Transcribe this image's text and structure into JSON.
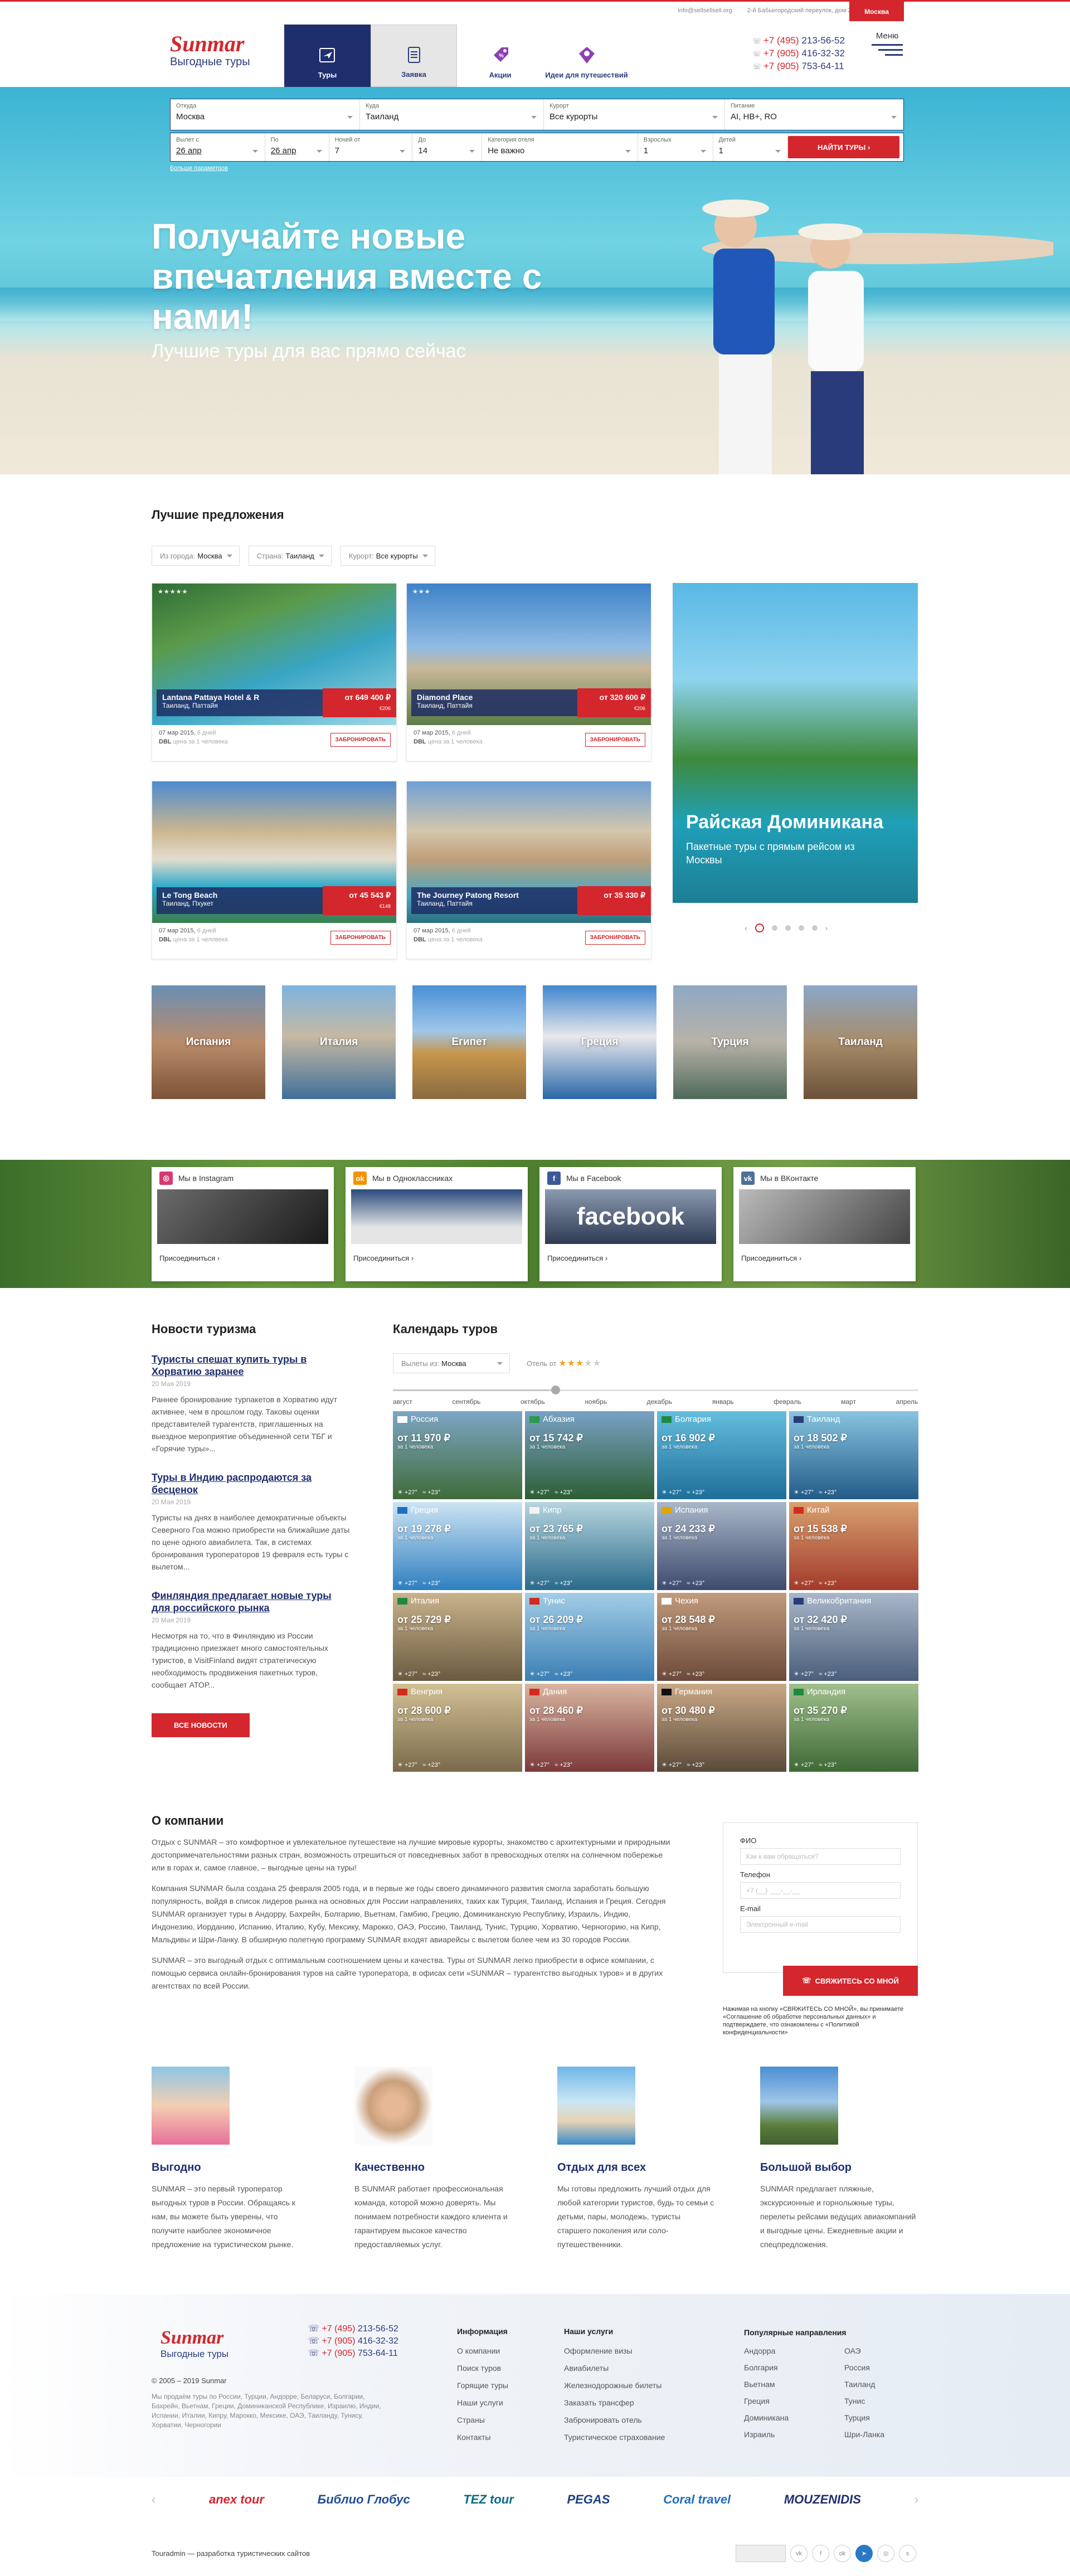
{
  "topbar": {
    "email": "info@sellsellsell.org",
    "address": "2-й Бабьегородский переулок, дом 2, офис 211, 4 этаж",
    "city": "Москва"
  },
  "header": {
    "logo_text": "Sunmar",
    "logo_sub": "Выгодные туры",
    "nav": [
      {
        "label": "Туры"
      },
      {
        "label": "Заявка"
      },
      {
        "label": "Акции"
      },
      {
        "label": "Идеи для путешествий"
      }
    ],
    "phones": [
      {
        "code": "+7 (495)",
        "num": "213-56-52"
      },
      {
        "code": "+7 (905)",
        "num": "416-32-32"
      },
      {
        "code": "+7 (905)",
        "num": "753-64-11"
      }
    ],
    "menu_label": "Меню"
  },
  "search": {
    "from_label": "Откуда",
    "from": "Москва",
    "to_label": "Куда",
    "to": "Таиланд",
    "resort_label": "Курорт",
    "resort": "Все курорты",
    "meal_label": "Питание",
    "meal": "AI, HB+, RO",
    "date1_label": "Вылет с",
    "date1": "26 апр",
    "date2_label": "По",
    "date2": "26 апр",
    "nights1_label": "Ночей от",
    "nights1": "7",
    "nights2_label": "До",
    "nights2": "14",
    "category_label": "Категория отеля",
    "category": "Не важно",
    "adults_label": "Взрослых",
    "adults": "1",
    "children_label": "Детей",
    "children": "1",
    "find": "НАЙТИ ТУРЫ",
    "more": "Больше параметров"
  },
  "hero": {
    "title": "Получайте новые впечатления вместе с нами!",
    "subtitle": "Лучшие туры для вас прямо сейчас"
  },
  "offers": {
    "title": "Лучшие предложения",
    "filters": [
      {
        "label": "Из города:",
        "value": "Москва"
      },
      {
        "label": "Страна:",
        "value": "Таиланд"
      },
      {
        "label": "Курорт:",
        "value": "Все курорты"
      }
    ],
    "cards": [
      {
        "stars": "★★★★★",
        "name": "Lantana Pattaya Hotel & R",
        "place": "Таиланд, Паттайя",
        "price": "от 649 400 ₽",
        "meal": "€206",
        "date": "07 мар 2015",
        "nights": "6 дней",
        "pax": "DBL",
        "people": "цена за 1 человека",
        "book": "ЗАБРОНИРОВАТЬ"
      },
      {
        "stars": "★★★",
        "name": "Diamond Place",
        "place": "Таиланд, Паттайя",
        "price": "от 320 600 ₽",
        "meal": "€206",
        "date": "07 мар 2015",
        "nights": "6 дней",
        "pax": "DBL",
        "people": "цена за 1 человека",
        "book": "ЗАБРОНИРОВАТЬ"
      },
      {
        "stars": "",
        "name": "Le Tong Beach",
        "place": "Таиланд, Пхукет",
        "price": "от 45 543 ₽",
        "meal": "€148",
        "date": "07 мар 2015",
        "nights": "6 дней",
        "pax": "DBL",
        "people": "цена за 1 человека",
        "book": "ЗАБРОНИРОВАТЬ"
      },
      {
        "stars": "",
        "name": "The Journey Patong Resort",
        "place": "Таиланд, Паттайя",
        "price": "от 35 330 ₽",
        "meal": "",
        "date": "07 мар 2015",
        "nights": "6 дней",
        "pax": "DBL",
        "people": "цена за 1 человека",
        "book": "ЗАБРОНИРОВАТЬ"
      }
    ],
    "promo_title": "Райская Доминикана",
    "promo_desc": "Пакетные туры с прямым рейсом из Москвы"
  },
  "countries": [
    "Испания",
    "Италия",
    "Египет",
    "Греция",
    "Турция",
    "Таиланд"
  ],
  "social": [
    {
      "name": "Мы в Instagram",
      "color": "#d53a73",
      "icon": "◎",
      "join": "Присоединиться"
    },
    {
      "name": "Мы в Одноклассниках",
      "color": "#f39200",
      "icon": "ok",
      "join": "Присоединиться"
    },
    {
      "name": "Мы в Facebook",
      "color": "#3b5998",
      "icon": "f",
      "join": "Присоединиться"
    },
    {
      "name": "Мы в ВКонтакте",
      "color": "#4d7198",
      "icon": "vk",
      "join": "Присоединиться"
    }
  ],
  "news": {
    "title": "Новости туризма",
    "items": [
      {
        "title": "Туристы спешат купить туры в Хорватию заранее",
        "date": "20 Мая 2019",
        "text": "Раннее бронирование турпакетов в Хорватию идут активнее, чем в прошлом году. Таковы оценки представителей турагентств, приглашенных на выездное мероприятие объединенной сети ТБГ и «Горячие туры»..."
      },
      {
        "title": "Туры в Индию распродаются за бесценок",
        "date": "20 Мая 2019",
        "text": "Туристы на днях в наиболее демократичные объекты Северного Гоа можно приобрести на ближайшие даты по цене одного авиабилета. Так, в системах бронирования туроператоров 19 февраля есть туры с вылетом..."
      },
      {
        "title": "Финляндия предлагает новые туры для российского рынка",
        "date": "20 Мая 2019",
        "text": "Несмотря на то, что в Финляндию из России традиционно приезжает много самостоятельных туристов, в VisitFinland видят стратегическую необходимость продвижения пакетных туров, сообщает АТОР..."
      }
    ],
    "all": "ВСЕ НОВОСТИ"
  },
  "calendar": {
    "title": "Календарь туров",
    "from_label": "Вылеты из:",
    "from": "Москва",
    "hotel_label": "Отель от",
    "hotel_stars": "★★★",
    "hotel_stars_empty": "★★",
    "slider_pos": 0.31,
    "months": [
      "август",
      "сентябрь",
      "октябрь",
      "ноябрь",
      "декабрь",
      "январь",
      "февраль",
      "март",
      "апрель"
    ],
    "tiles": [
      {
        "country": "Россия",
        "price": "от 11 970 ₽",
        "note": "за 1 человека",
        "flag": "#fff",
        "colors": [
          "#3f6b3a",
          "#7da6c4"
        ]
      },
      {
        "country": "Абхазия",
        "price": "от 15 742 ₽",
        "note": "за 1 человека",
        "flag": "#2a9a4a",
        "colors": [
          "#2d5e35",
          "#78a2c5"
        ]
      },
      {
        "country": "Болгария",
        "price": "от 16 902 ₽",
        "note": "за 1 человека",
        "flag": "#1e8a3e",
        "colors": [
          "#1e6e9a",
          "#64bedd"
        ]
      },
      {
        "country": "Таиланд",
        "price": "от 18 502 ₽",
        "note": "за 1 человека",
        "flag": "#2a3b7c",
        "colors": [
          "#235b88",
          "#88c4e0"
        ]
      },
      {
        "country": "Греция",
        "price": "от 19 278 ₽",
        "note": "за 1 человека",
        "flag": "#1f6fc0",
        "colors": [
          "#2e7fc0",
          "#cde4f3"
        ]
      },
      {
        "country": "Кипр",
        "price": "от 23 765 ₽",
        "note": "за 1 человека",
        "flag": "#f3f3f3",
        "colors": [
          "#2a6a8a",
          "#b6d5df"
        ]
      },
      {
        "country": "Испания",
        "price": "от 24 233 ₽",
        "note": "за 1 человека",
        "flag": "#e1a400",
        "colors": [
          "#3d4a6d",
          "#a9b7c9"
        ]
      },
      {
        "country": "Китай",
        "price": "от 15 538 ₽",
        "note": "за 1 человека",
        "flag": "#d42a1d",
        "colors": [
          "#a33a2a",
          "#d7a06f"
        ]
      },
      {
        "country": "Италия",
        "price": "от 25 729 ₽",
        "note": "за 1 человека",
        "flag": "#1d8a3e",
        "colors": [
          "#6a5a40",
          "#c9b38c"
        ]
      },
      {
        "country": "Тунис",
        "price": "от 26 209 ₽",
        "note": "за 1 человека",
        "flag": "#d42a1d",
        "colors": [
          "#3c7fb4",
          "#a2cde6"
        ]
      },
      {
        "country": "Чехия",
        "price": "от 28 548 ₽",
        "note": "за 1 человека",
        "flag": "#fff",
        "colors": [
          "#6b4a3a",
          "#c29b7c"
        ]
      },
      {
        "country": "Великобритания",
        "price": "от 32 420 ₽",
        "note": "за 1 человека",
        "flag": "#2a3b7c",
        "colors": [
          "#4a5e7a",
          "#a9b7c9"
        ]
      },
      {
        "country": "Венгрия",
        "price": "от 28 600 ₽",
        "note": "за 1 человека",
        "flag": "#d42a1d",
        "colors": [
          "#7a6a4a",
          "#d2c095"
        ]
      },
      {
        "country": "Дания",
        "price": "от 28 460 ₽",
        "note": "за 1 человека",
        "flag": "#d42a1d",
        "colors": [
          "#7c3a3a",
          "#d9b5a0"
        ]
      },
      {
        "country": "Германия",
        "price": "от 30 480 ₽",
        "note": "за 1 человека",
        "flag": "#111",
        "colors": [
          "#5a4a3a",
          "#c9a886"
        ]
      },
      {
        "country": "Ирландия",
        "price": "от 35 270 ₽",
        "note": "за 1 человека",
        "flag": "#1d8a3e",
        "colors": [
          "#3e6a35",
          "#9fbf8c"
        ]
      }
    ]
  },
  "about": {
    "title": "О компании",
    "p1": "Отдых с SUNMAR – это комфортное и увлекательное путешествие на лучшие мировые курорты, знакомство с архитектурными и природными достопримечательностями разных стран, возможность отрешиться от повседневных забот в превосходных отелях на солнечном побережье или в горах и, самое главное, – выгодные цены на туры!",
    "p2": "Компания SUNMAR была создана 25 февраля 2005 года, и в первые же годы своего динамичного развития смогла заработать большую популярность, войдя в список лидеров рынка на основных для России направлениях, таких как Турция, Таиланд, Испания и Греция. Сегодня SUNMAR организует туры в Андорру, Бахрейн, Болгарию, Вьетнам, Гамбию, Грецию, Доминиканскую Республику, Израиль, Индию, Индонезию, Иорданию, Испанию, Италию, Кубу, Мексику, Марокко, ОАЭ, Россию, Таиланд, Тунис, Турцию, Хорватию, Черногорию, на Кипр, Мальдивы и Шри-Ланку. В обширную полетную программу SUNMAR входят авиарейсы с вылетом более чем из 30 городов России.",
    "p3": "SUNMAR – это выгодный отдых с оптимальным соотношением цены и качества. Туры от SUNMAR легко приобрести в офисе компании, с помощью сервиса онлайн-бронирования туров на сайте туроператора, в офисах сети «SUNMAR – турагентство выгодных туров» и в других агентствах по всей России."
  },
  "form": {
    "name_label": "ФИО",
    "name_ph": "Как к вам обращаться?",
    "phone_label": "Телефон",
    "phone_ph": "+7 (__) ___-__-__",
    "email_label": "E-mail",
    "email_ph": "Электронный e-mail",
    "send": "СВЯЖИТЕСЬ СО МНОЙ",
    "note": "Нажимая на кнопку «СВЯЖИТЕСЬ СО МНОЙ», вы принимаете «Соглашение об обработке персональных данных» и подтверждаете, что ознакомлены с «Политикой конфиденциальности»"
  },
  "features": [
    {
      "title": "Выгодно",
      "text": "SUNMAR – это первый туроператор выгодных туров в России. Обращаясь к нам, вы можете быть уверены, что получите наиболее экономичное предложение на туристическом рынке."
    },
    {
      "title": "Качественно",
      "text": "В SUNMAR работает профессиональная команда, которой можно доверять. Мы понимаем потребности каждого клиента и гарантируем высокое качество предоставляемых услуг."
    },
    {
      "title": "Отдых для всех",
      "text": "Мы готовы предложить лучший отдых для любой категории туристов, будь то семьи с детьми, пары, молодежь, туристы старшего поколения или соло-путешественники."
    },
    {
      "title": "Большой выбор",
      "text": "SUNMAR предлагает пляжные, экскурсионные и горнолыжные туры, перелеты рейсами ведущих авиакомпаний и выгодные цены. Ежедневные акции и спецпредложения."
    }
  ],
  "footer": {
    "copy": "© 2005 – 2019 Sunmar",
    "desc": "Мы продаём туры по России, Турции, Андорре, Беларуси, Болгарии, Бахрейн, Вьетнам, Греции, Доминиканской Республике, Израилю, Индии, Испании, Италии, Кипру, Марокко, Мексике, ОАЭ, Таиланду, Тунису, Хорватии, Черногории",
    "info_title": "Информация",
    "info": [
      "О компании",
      "Поиск туров",
      "Горящие туры",
      "Наши услуги",
      "Страны",
      "Контакты"
    ],
    "services_title": "Наши услуги",
    "services": [
      "Оформление визы",
      "Авиабилеты",
      "Железнодорожные билеты",
      "Заказать трансфер",
      "Забронировать отель",
      "Туристическое страхование"
    ],
    "dir_title": "Популярные направления",
    "dirs_left": [
      "Андорра",
      "Болгария",
      "Вьетнам",
      "Греция",
      "Доминикана",
      "Израиль"
    ],
    "dirs_right": [
      "ОАЭ",
      "Россия",
      "Таиланд",
      "Тунис",
      "Турция",
      "Шри-Ланка"
    ]
  },
  "partners": [
    "anex tour",
    "Библио Глобус",
    "TEZ tour",
    "PEGAS",
    "Coral travel",
    "MOUZENIDIS"
  ],
  "bottom": "Touradmin — разработка туристических сайтов"
}
